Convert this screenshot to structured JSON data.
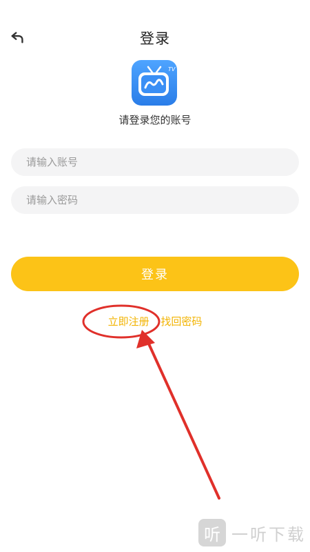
{
  "header": {
    "title": "登录",
    "back_icon": "back-arrow-icon"
  },
  "logo": {
    "icon": "tv-app-logo-icon",
    "brand_color": "#3a8ff5"
  },
  "subtitle": "请登录您的账号",
  "form": {
    "account_placeholder": "请输入账号",
    "account_value": "",
    "password_placeholder": "请输入密码",
    "password_value": ""
  },
  "login_button": {
    "label": "登录",
    "color": "#fcc317"
  },
  "links": {
    "register": "立即注册",
    "forgot_password": "找回密码",
    "color": "#f2b300"
  },
  "annotation": {
    "color": "#e0302a"
  },
  "watermark": {
    "icon_glyph": "听",
    "text": "一听下载"
  }
}
